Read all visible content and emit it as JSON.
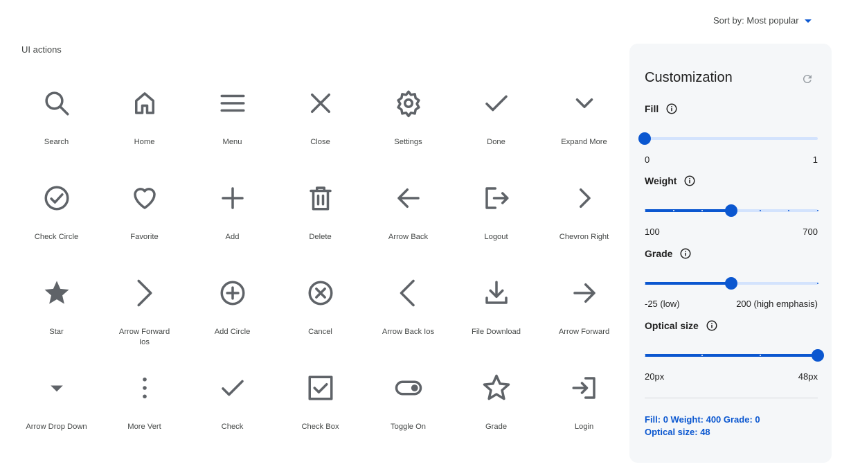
{
  "sort": {
    "label": "Sort by: Most popular"
  },
  "section": {
    "title": "UI actions"
  },
  "icons": [
    {
      "label": "Search",
      "icon": "search"
    },
    {
      "label": "Home",
      "icon": "home"
    },
    {
      "label": "Menu",
      "icon": "menu"
    },
    {
      "label": "Close",
      "icon": "close"
    },
    {
      "label": "Settings",
      "icon": "settings"
    },
    {
      "label": "Done",
      "icon": "done"
    },
    {
      "label": "Expand More",
      "icon": "expand_more"
    },
    {
      "label": "Check Circle",
      "icon": "check_circle"
    },
    {
      "label": "Favorite",
      "icon": "favorite"
    },
    {
      "label": "Add",
      "icon": "add"
    },
    {
      "label": "Delete",
      "icon": "delete"
    },
    {
      "label": "Arrow Back",
      "icon": "arrow_back"
    },
    {
      "label": "Logout",
      "icon": "logout"
    },
    {
      "label": "Chevron Right",
      "icon": "chevron_right"
    },
    {
      "label": "Star",
      "icon": "star"
    },
    {
      "label": "Arrow Forward Ios",
      "icon": "arrow_forward_ios"
    },
    {
      "label": "Add Circle",
      "icon": "add_circle"
    },
    {
      "label": "Cancel",
      "icon": "cancel"
    },
    {
      "label": "Arrow Back Ios",
      "icon": "arrow_back_ios"
    },
    {
      "label": "File Download",
      "icon": "file_download"
    },
    {
      "label": "Arrow Forward",
      "icon": "arrow_forward"
    },
    {
      "label": "Arrow Drop Down",
      "icon": "arrow_drop_down"
    },
    {
      "label": "More Vert",
      "icon": "more_vert"
    },
    {
      "label": "Check",
      "icon": "check"
    },
    {
      "label": "Check Box",
      "icon": "check_box"
    },
    {
      "label": "Toggle On",
      "icon": "toggle_on"
    },
    {
      "label": "Grade",
      "icon": "grade"
    },
    {
      "label": "Login",
      "icon": "login"
    }
  ],
  "customization": {
    "title": "Customization",
    "reset_icon": "refresh-icon",
    "fill": {
      "label": "Fill",
      "min_label": "0",
      "max_label": "1",
      "value_fraction": 0.0,
      "steps": 0
    },
    "weight": {
      "label": "Weight",
      "min_label": "100",
      "max_label": "700",
      "value_fraction": 0.5,
      "steps": 6
    },
    "grade": {
      "label": "Grade",
      "min_label": "-25 (low)",
      "max_label": "200 (high emphasis)",
      "value_fraction": 0.5,
      "steps": 2
    },
    "optical": {
      "label": "Optical size",
      "min_label": "20px",
      "max_label": "48px",
      "value_fraction": 1.0,
      "steps": 3
    },
    "summary_line1": "Fill: 0 Weight: 400 Grade: 0",
    "summary_line2": "Optical size: 48"
  },
  "colors": {
    "accent": "#0b57d0",
    "track": "#d3e3fd",
    "icon": "#5f6368",
    "panel": "#f5f7f9"
  }
}
